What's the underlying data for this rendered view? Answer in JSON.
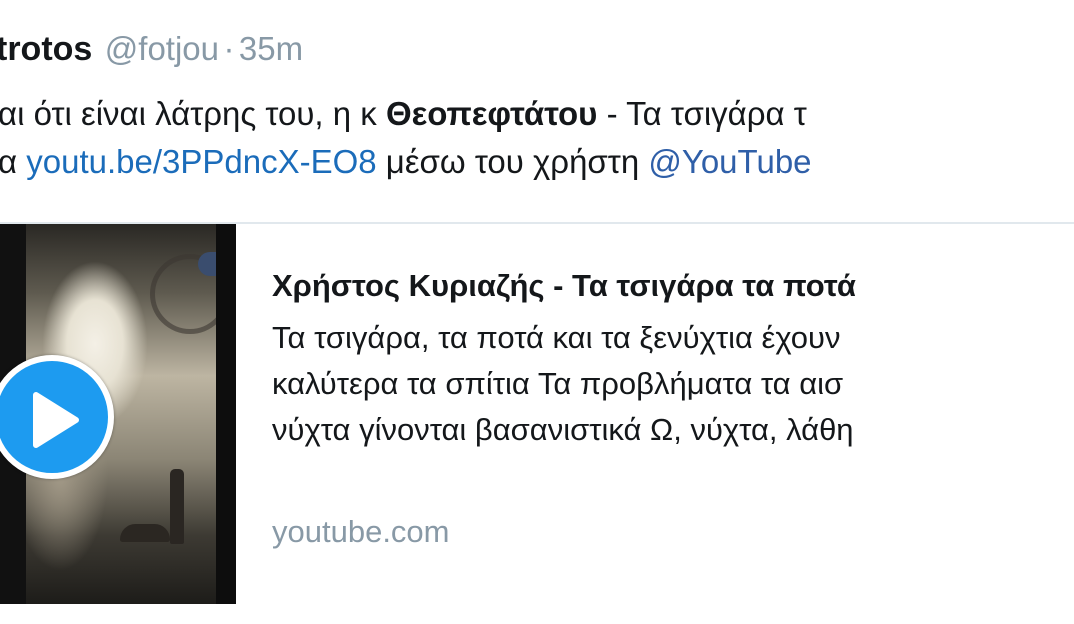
{
  "tweet": {
    "author_name": "trotos",
    "handle": "@fotjou",
    "separator": "·",
    "time": "35m",
    "text_line1_prefix": "αι ότι είναι  λάτρης του, η κ ",
    "text_line1_bold": "Θεοπεφτάτου",
    "text_line1_suffix": " - Τα τσιγάρα τ",
    "text_line2_prefix": "α ",
    "text_line2_link": "youtu.be/3PPdncX-EO8",
    "text_line2_middle": " μέσω του χρήστη ",
    "text_line2_mention": "@YouTube"
  },
  "card": {
    "title": "Χρήστος Κυριαζής - Τα τσιγάρα τα ποτά",
    "description_lines": [
      "Τα τσιγάρα, τα ποτά και τα ξενύχτια έχουν",
      "καλύτερα τα σπίτια Τα προβλήματα τα αισ",
      "νύχτα γίνονται βασανιστικά Ω, νύχτα, λάθη"
    ],
    "domain": "youtube.com",
    "thumbnail_icon": "video-thumbnail",
    "play_icon": "play-icon"
  },
  "colors": {
    "link": "#1b6cba",
    "muted": "#8899a6",
    "play_button": "#1d9bf0"
  }
}
